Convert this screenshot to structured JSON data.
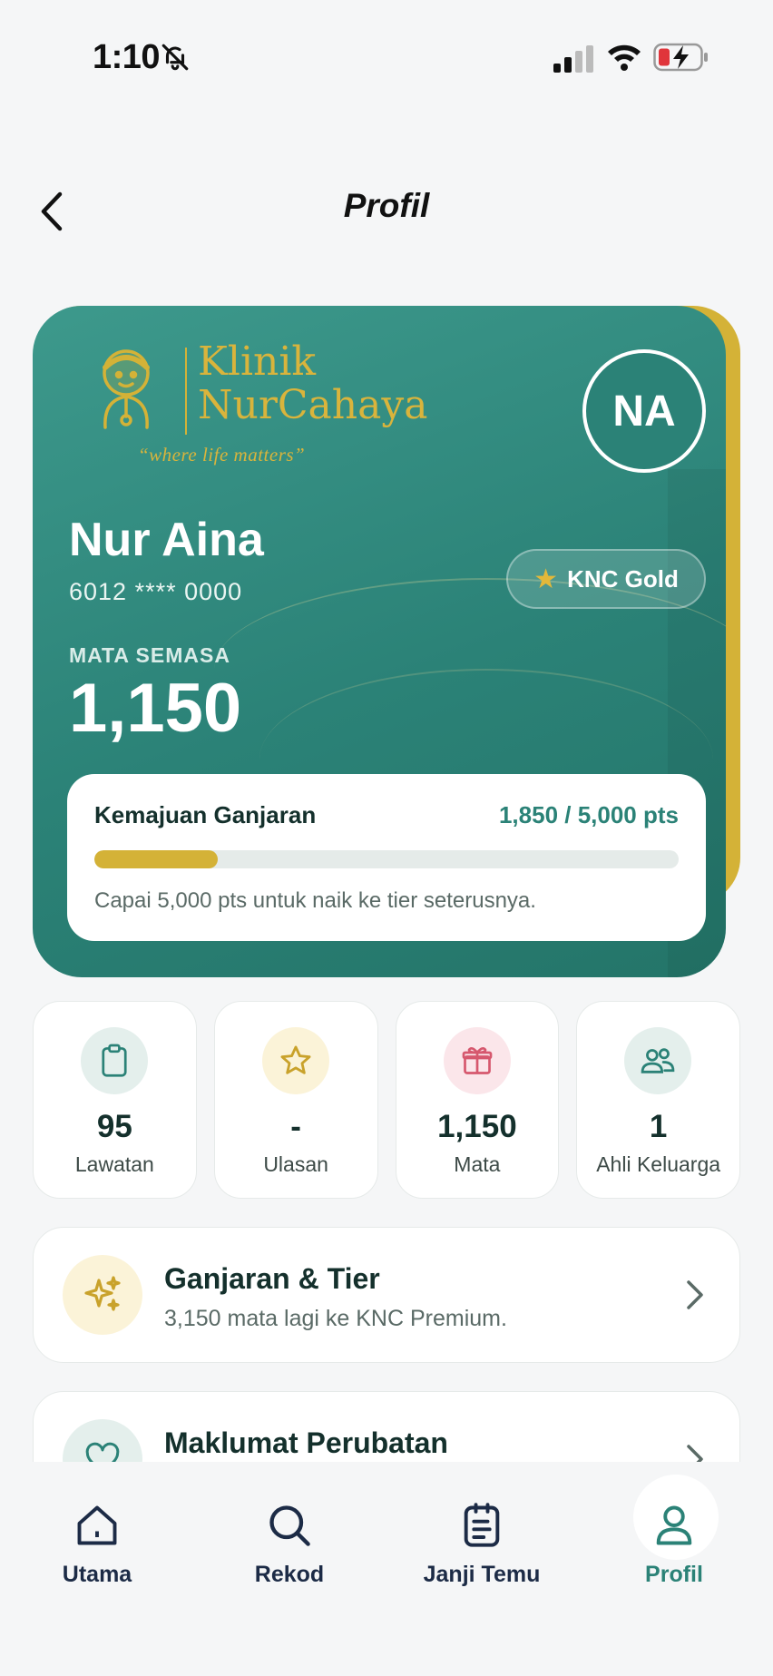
{
  "status_bar": {
    "time": "1:10"
  },
  "header": {
    "title": "Profil"
  },
  "card": {
    "brand_line1": "Klinik",
    "brand_line2": "NurCahaya",
    "brand_tagline": "“where life matters”",
    "initials": "NA",
    "name": "Nur Aina",
    "phone": "6012 **** 0000",
    "tier": "KNC Gold",
    "points_label": "MATA SEMASA",
    "points_value": "1,150",
    "progress": {
      "title": "Kemajuan Ganjaran",
      "value_text": "1,850 / 5,000 pts",
      "current": 1850,
      "target": 5000,
      "note": "Capai 5,000 pts untuk naik ke tier seterusnya."
    }
  },
  "stats": [
    {
      "icon": "clipboard-icon",
      "value": "95",
      "label": "Lawatan"
    },
    {
      "icon": "star-icon",
      "value": "-",
      "label": "Ulasan"
    },
    {
      "icon": "gift-icon",
      "value": "1,150",
      "label": "Mata"
    },
    {
      "icon": "users-icon",
      "value": "1",
      "label": "Ahli Keluarga"
    }
  ],
  "menu": [
    {
      "icon": "sparkles-icon",
      "title": "Ganjaran & Tier",
      "subtitle": "3,150 mata lagi ke KNC Premium."
    },
    {
      "icon": "heart-icon",
      "title": "Maklumat Perubatan"
    }
  ],
  "nav": [
    {
      "icon": "home-icon",
      "label": "Utama"
    },
    {
      "icon": "search-icon",
      "label": "Rekod"
    },
    {
      "icon": "calendar-doc-icon",
      "label": "Janji Temu"
    },
    {
      "icon": "user-icon",
      "label": "Profil",
      "active": true
    }
  ],
  "colors": {
    "teal": "#2b8277",
    "gold": "#d4b237",
    "navy": "#1c2b46"
  }
}
